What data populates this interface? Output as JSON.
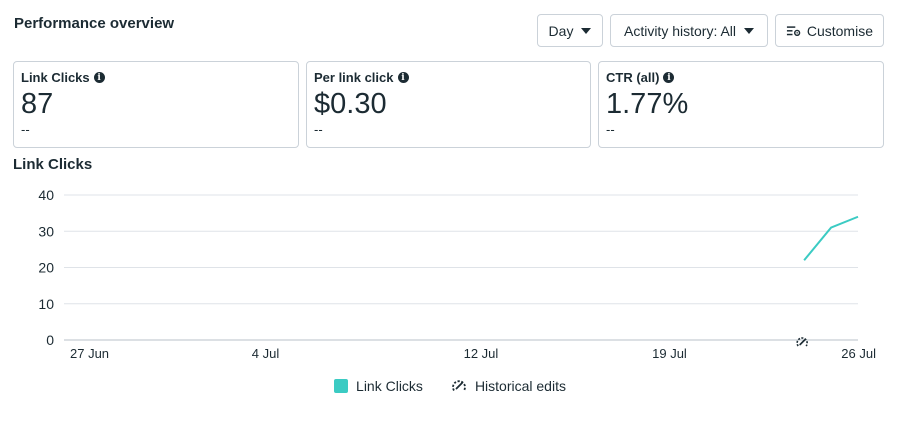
{
  "header": {
    "title": "Performance overview",
    "day_label": "Day",
    "activity_label": "Activity history: All",
    "customise_label": "Customise"
  },
  "cards": [
    {
      "label": "Link Clicks",
      "value": "87",
      "sub": "--"
    },
    {
      "label": "Per link click",
      "value": "$0.30",
      "sub": "--"
    },
    {
      "label": "CTR (all)",
      "value": "1.77%",
      "sub": "--"
    }
  ],
  "chart": {
    "title": "Link Clicks"
  },
  "legend": {
    "series_label": "Link Clicks",
    "edits_label": "Historical edits"
  },
  "colors": {
    "series": "#3bcbc3",
    "grid": "#dfe3e8",
    "text": "#1c2b33"
  },
  "chart_data": {
    "type": "line",
    "title": "Link Clicks",
    "xlabel": "",
    "ylabel": "",
    "x_tick_labels": [
      "27 Jun",
      "4 Jul",
      "12 Jul",
      "19 Jul",
      "26 Jul"
    ],
    "y_ticks": [
      0,
      10,
      20,
      30,
      40
    ],
    "ylim": [
      0,
      40
    ],
    "xlim": [
      "27 Jun",
      "26 Jul"
    ],
    "grid": true,
    "legend_position": "bottom-center",
    "series": [
      {
        "name": "Link Clicks",
        "x": [
          "24 Jul",
          "25 Jul",
          "26 Jul"
        ],
        "values": [
          22,
          31,
          34
        ]
      }
    ],
    "annotations": [
      {
        "type": "historical-edit",
        "x": "24 Jul"
      }
    ]
  }
}
